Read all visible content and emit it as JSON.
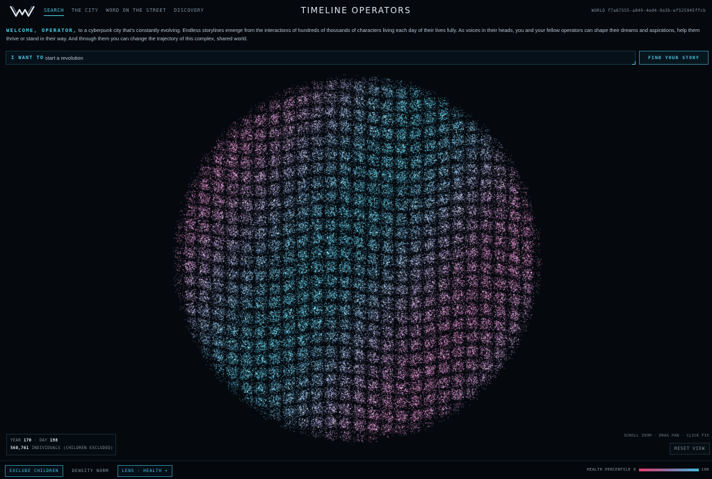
{
  "header": {
    "title": "TIMELINE OPERATORS",
    "nav": [
      "SEARCH",
      "THE CITY",
      "WORD ON THE STREET",
      "DISCOVERY"
    ],
    "active_nav": "SEARCH",
    "world_id": "WORLD f7a87555-a849-4ed4-9a3b-ef525945ffcb"
  },
  "welcome": {
    "highlight": "WELCOME, OPERATOR,",
    "text": " to a cyberpunk city that's constantly evolving. Endless storylines emerge from the interactions of hundreds of thousands of characters living each day of their lives fully. As voices in their heads, you and your fellow operators can shape their dreams and aspirations, help them thrive or stand in their way. And through them you can change the trajectory of this complex, shared world."
  },
  "search": {
    "prefix": "I WANT TO",
    "value": "start a revolution",
    "button": "FIND YOUR STORY"
  },
  "info": {
    "year_label": "YEAR",
    "year": "170",
    "day_label": "DAY",
    "day": "198",
    "count": "568,761",
    "count_suffix": "INDIVIDUALS (CHILDREN EXCLUDED)"
  },
  "controls": {
    "hint": "SCROLL ZOOM · DRAG PAN · CLICK FIX",
    "reset": "RESET VIEW"
  },
  "footer": {
    "exclude": "EXCLUDE CHILDREN",
    "density": "DENSITY NORM",
    "lens": "LENS · HEALTH ▾",
    "legend_label": "HEALTH PERCENTILE",
    "legend_min": "0",
    "legend_max": "100"
  },
  "colors": {
    "accent": "#4cc6e6",
    "low": "#e33c6b",
    "high": "#3fb9d8",
    "background": "#05090e"
  }
}
